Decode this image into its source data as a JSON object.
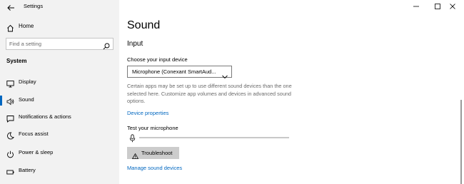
{
  "window": {
    "title": "Settings"
  },
  "sidebar": {
    "home_label": "Home",
    "search_placeholder": "Find a setting",
    "section_label": "System",
    "items": [
      {
        "label": "Display",
        "icon": "monitor-icon",
        "selected": false
      },
      {
        "label": "Sound",
        "icon": "speaker-icon",
        "selected": true
      },
      {
        "label": "Notifications & actions",
        "icon": "notifications-icon",
        "selected": false
      },
      {
        "label": "Focus assist",
        "icon": "moon-icon",
        "selected": false
      },
      {
        "label": "Power & sleep",
        "icon": "power-icon",
        "selected": false
      },
      {
        "label": "Battery",
        "icon": "battery-icon",
        "selected": false
      }
    ]
  },
  "main": {
    "title": "Sound",
    "section_title": "Input",
    "device_label": "Choose your input device",
    "device_value": "Microphone (Conexant SmartAud...",
    "help_text": "Certain apps may be set up to use different sound devices than the one selected here. Customize app volumes and devices in advanced sound options.",
    "device_properties_link": "Device properties",
    "test_mic_label": "Test your microphone",
    "mic_level": 0,
    "troubleshoot_label": "Troubleshoot",
    "manage_link": "Manage sound devices"
  },
  "colors": {
    "accent": "#0067c0",
    "sidebar_bg": "#f2f2f2",
    "button_bg": "#cccccc"
  }
}
